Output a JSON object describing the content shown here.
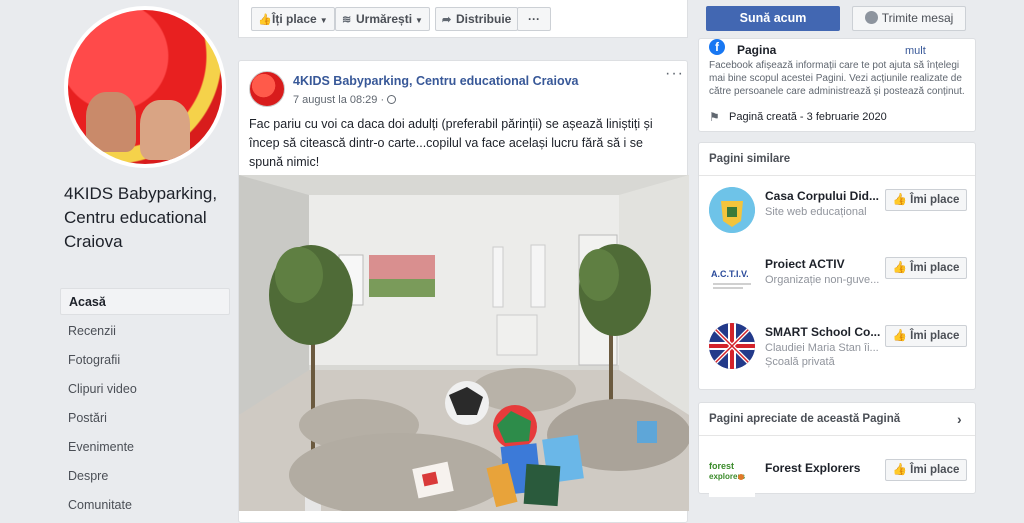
{
  "page": {
    "name": "4KIDS Babyparking, Centru educational Craiova",
    "nav": [
      {
        "label": "Acasă",
        "active": true
      },
      {
        "label": "Recenzii"
      },
      {
        "label": "Fotografii"
      },
      {
        "label": "Clipuri video"
      },
      {
        "label": "Postări"
      },
      {
        "label": "Evenimente"
      },
      {
        "label": "Despre"
      },
      {
        "label": "Comunitate"
      }
    ]
  },
  "action_bar": {
    "like_label": "Îți place",
    "follow_label": "Urmărești",
    "share_label": "Distribuie",
    "more_label": "···"
  },
  "cta": {
    "primary_label": "Sună acum",
    "message_label": "Trimite mesaj"
  },
  "post": {
    "author": "4KIDS Babyparking, Centru educational Craiova",
    "time": "7 august la 08:29 ·",
    "more": "···",
    "text": "Fac pariu cu voi ca daca doi adulți (preferabil părinții) se așează liniștiți și încep să citească dintr-o carte...copilul va face același lucru fără să i se spună nimic!"
  },
  "transparency": {
    "title": "Pagina",
    "more": "mult",
    "description": "Facebook afișează informații care te pot ajuta să înțelegi mai bine scopul acestei Pagini. Vezi acțiunile realizate de către persoanele care administrează și postează conținut.",
    "created": "Pagină creată - 3 februarie 2020"
  },
  "similar_pages": {
    "title": "Pagini similare",
    "items": [
      {
        "name": "Casa Corpului Did...",
        "sub": "Site web educațional",
        "sub2": "",
        "like": "Îmi place"
      },
      {
        "name": "Proiect ACTIV",
        "sub": "Organizație non-guve...",
        "sub2": "",
        "like": "Îmi place"
      },
      {
        "name": "SMART School Co...",
        "sub": "Claudiei Maria Stan îi...",
        "sub2": "Școală privată",
        "like": "Îmi place"
      }
    ]
  },
  "liked_pages": {
    "title": "Pagini apreciate de această Pagină",
    "items": [
      {
        "name": "Forest Explorers",
        "logo_text": "forest explorers",
        "like": "Îmi place"
      }
    ]
  },
  "colors": {
    "fb_blue": "#4267b2",
    "link": "#385898",
    "background": "#e9ebee"
  }
}
